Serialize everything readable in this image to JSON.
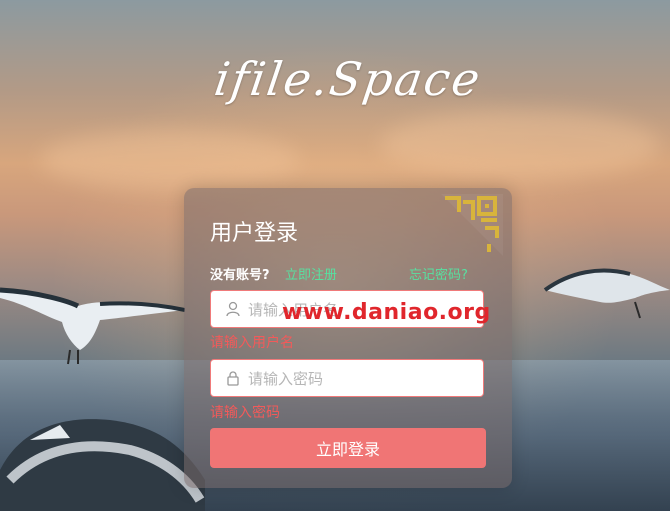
{
  "brand": {
    "logo_text": "ifile.Space"
  },
  "login": {
    "title": "用户登录",
    "no_account_label": "没有账号?",
    "register_link": "立即注册",
    "forgot_link": "忘记密码?",
    "username": {
      "placeholder": "请输入用户名",
      "error": "请输入用户名"
    },
    "password": {
      "placeholder": "请输入密码",
      "error": "请输入密码"
    },
    "submit_label": "立即登录"
  },
  "watermark": {
    "text": "www.daniao.org"
  },
  "colors": {
    "accent": "#f07575",
    "link": "#58e0a0",
    "error": "#f25a5a",
    "watermark": "#e0262c",
    "qr": "#d8b43c"
  },
  "icons": {
    "user": "user-icon",
    "lock": "lock-icon",
    "qr": "qr-code-icon"
  }
}
